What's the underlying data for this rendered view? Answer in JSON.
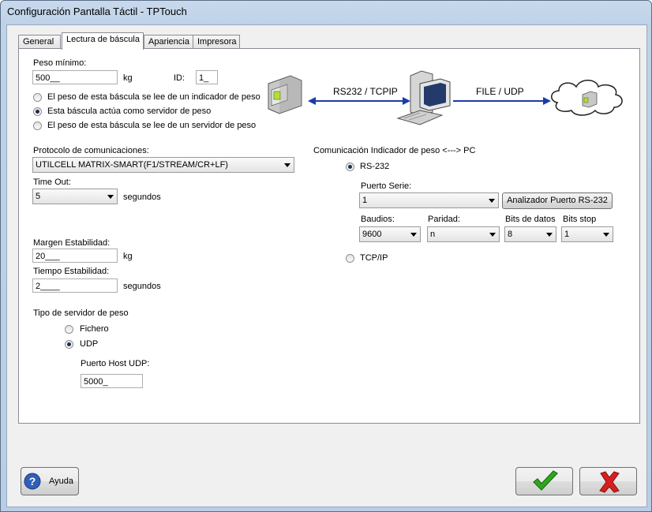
{
  "window": {
    "title": "Configuración Pantalla Táctil - TPTouch"
  },
  "tabs": [
    "General",
    "Lectura de báscula",
    "Apariencia",
    "Impresora"
  ],
  "peso_minimo": {
    "label": "Peso mínimo:",
    "value": "500__",
    "unit": "kg",
    "id_label": "ID:",
    "id_value": "1_"
  },
  "source_options": [
    {
      "label": "El peso de esta báscula se lee de un indicador de peso",
      "selected": false
    },
    {
      "label": "Esta báscula actúa como servidor de peso",
      "selected": true
    },
    {
      "label": "El peso de esta báscula se lee de un servidor de peso",
      "selected": false
    }
  ],
  "diagram": {
    "link1": "RS232 / TCPIP",
    "link2": "FILE / UDP"
  },
  "protocolo": {
    "label": "Protocolo de comunicaciones:",
    "value": "UTILCELL MATRIX-SMART(F1/STREAM/CR+LF)"
  },
  "timeout": {
    "label": "Time Out:",
    "value": "5",
    "unit": "segundos"
  },
  "margen": {
    "label": "Margen Estabilidad:",
    "value": "20___",
    "unit": "kg"
  },
  "tiempo": {
    "label": "Tiempo Estabilidad:",
    "value": "2____",
    "unit": "segundos"
  },
  "servidor": {
    "label": "Tipo de servidor de peso",
    "options": [
      {
        "label": "Fichero",
        "selected": false
      },
      {
        "label": "UDP",
        "selected": true
      }
    ],
    "puerto_label": "Puerto Host UDP:",
    "puerto_value": "5000_"
  },
  "comunicacion": {
    "label": "Comunicación Indicador de peso <---> PC",
    "rs232_label": "RS-232",
    "rs232_selected": true,
    "puerto_serie_label": "Puerto Serie:",
    "puerto_serie_value": "1",
    "analizador_label": "Analizador Puerto RS-232",
    "baudios_label": "Baudios:",
    "baudios_value": "9600",
    "paridad_label": "Paridad:",
    "paridad_value": "n",
    "bits_datos_label": "Bits de datos",
    "bits_datos_value": "8",
    "bits_stop_label": "Bits stop",
    "bits_stop_value": "1",
    "tcpip_label": "TCP/IP",
    "tcpip_selected": false
  },
  "footer": {
    "help_label": "Ayuda"
  },
  "colors": {
    "arrow": "#1a3ca6",
    "ok": "#2ea81c",
    "cancel": "#d42020"
  }
}
